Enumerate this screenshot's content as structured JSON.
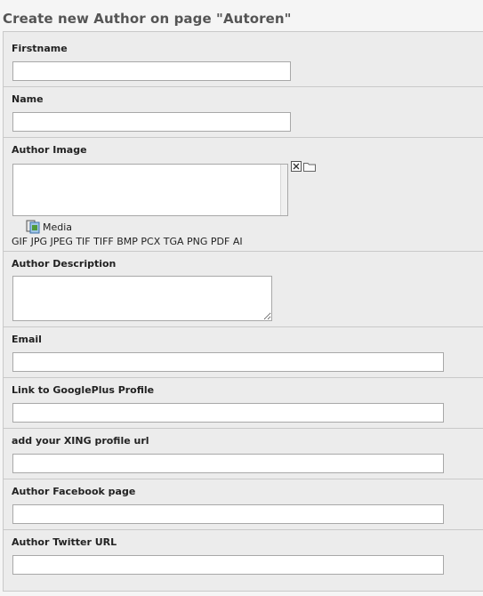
{
  "page": {
    "title": "Create new Author on page \"Autoren\""
  },
  "fields": {
    "firstname": {
      "label": "Firstname",
      "value": ""
    },
    "name": {
      "label": "Name",
      "value": ""
    },
    "author_image": {
      "label": "Author Image",
      "media_label": "Media",
      "allowed_types": "GIF JPG JPEG TIF TIFF BMP PCX TGA PNG PDF AI",
      "delete_icon": "delete-x-icon",
      "browse_icon": "folder-icon",
      "media_icon": "media-icon"
    },
    "author_description": {
      "label": "Author Description",
      "value": ""
    },
    "email": {
      "label": "Email",
      "value": ""
    },
    "googleplus": {
      "label": "Link to GooglePlus Profile",
      "value": ""
    },
    "xing": {
      "label": "add your XING profile url",
      "value": ""
    },
    "facebook": {
      "label": "Author Facebook page",
      "value": ""
    },
    "twitter": {
      "label": "Author Twitter URL",
      "value": ""
    }
  },
  "colors": {
    "form_background": "#ececec",
    "page_background": "#f5f5f5",
    "border": "#c9c9c9",
    "title_text": "#555555"
  }
}
